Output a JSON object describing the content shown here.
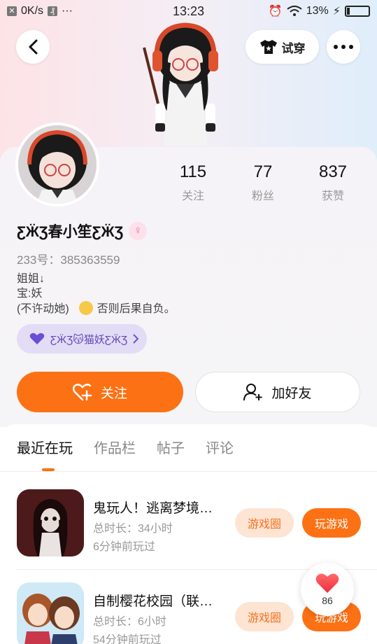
{
  "status_bar": {
    "network_speed": "0K/s",
    "time": "13:23",
    "battery_percent": "13%"
  },
  "header": {
    "tryon_label": "试穿"
  },
  "profile": {
    "stats": [
      {
        "num": "115",
        "label": "关注"
      },
      {
        "num": "77",
        "label": "粉丝"
      },
      {
        "num": "837",
        "label": "获赞"
      }
    ],
    "username": "ƸӜƷ春小笙ƸӜƷ",
    "gender_symbol": "♀",
    "uid": "233号：385363559",
    "bio_lines": [
      "姐姐↓",
      "宝:妖",
      "(不许动她)"
    ],
    "bio_suffix": "否则后果自负。",
    "club_tag": "ƸӜƷ😽猫妖ƸӜƷ",
    "follow_label": "关注",
    "add_friend_label": "加好友"
  },
  "tabs": [
    {
      "label": "最近在玩",
      "active": true
    },
    {
      "label": "作品栏",
      "active": false
    },
    {
      "label": "帖子",
      "active": false
    },
    {
      "label": "评论",
      "active": false
    }
  ],
  "games": [
    {
      "title": "鬼玩人！逃离梦境…",
      "duration": "总时长：34小时",
      "last_played": "6分钟前玩过",
      "circle_label": "游戏圈",
      "play_label": "玩游戏"
    },
    {
      "title": "自制樱花校园（联…",
      "duration": "总时长：6小时",
      "last_played": "54分钟前玩过",
      "circle_label": "游戏圈",
      "play_label": "玩游戏"
    }
  ],
  "like_bubble": {
    "count": "86"
  },
  "colors": {
    "accent": "#fc7114",
    "accent_light": "#fde4d3",
    "club_bg": "#e2dcf5"
  }
}
